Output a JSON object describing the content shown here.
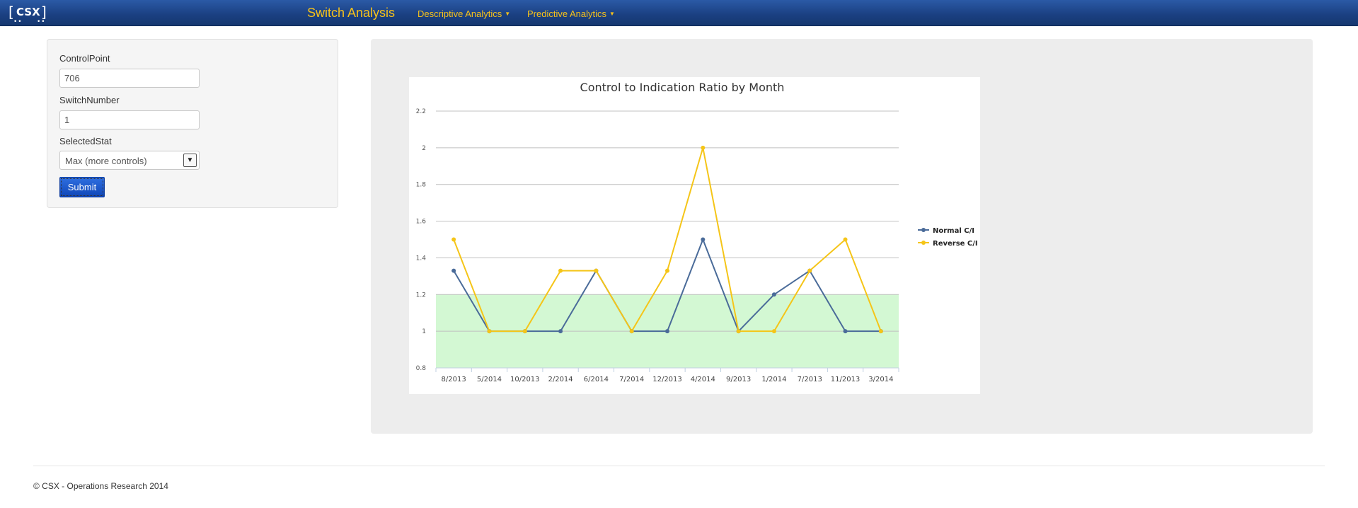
{
  "navbar": {
    "logo_text": "CSX",
    "brand": "Switch Analysis",
    "menus": [
      {
        "label": "Descriptive Analytics"
      },
      {
        "label": "Predictive Analytics"
      }
    ]
  },
  "sidebar": {
    "control_point_label": "ControlPoint",
    "control_point_value": "706",
    "switch_number_label": "SwitchNumber",
    "switch_number_value": "1",
    "selected_stat_label": "SelectedStat",
    "selected_stat_value": "Max (more controls)",
    "submit_label": "Submit"
  },
  "footer": {
    "text": "© CSX - Operations Research 2014"
  },
  "chart_data": {
    "type": "line",
    "title": "Control to Indication Ratio by Month",
    "categories": [
      "8/2013",
      "5/2014",
      "10/2013",
      "2/2014",
      "6/2014",
      "7/2014",
      "12/2013",
      "4/2014",
      "9/2013",
      "1/2014",
      "7/2013",
      "11/2013",
      "3/2014"
    ],
    "yticks": [
      "0.8",
      "1",
      "1.2",
      "1.4",
      "1.6",
      "1.8",
      "2",
      "2.2"
    ],
    "ylim": [
      0.8,
      2.2
    ],
    "band": {
      "from": 0.8,
      "to": 1.2,
      "color": "#d3f8d3"
    },
    "grid": true,
    "legend_position": "right",
    "series": [
      {
        "name": "Normal C/I",
        "color": "#4a6b99",
        "values": [
          1.33,
          1.0,
          1.0,
          1.0,
          1.33,
          1.0,
          1.0,
          1.5,
          1.0,
          1.2,
          1.33,
          1.0,
          1.0
        ]
      },
      {
        "name": "Reverse C/I",
        "color": "#f5c518",
        "values": [
          1.5,
          1.0,
          1.0,
          1.33,
          1.33,
          1.0,
          1.33,
          2.0,
          1.0,
          1.0,
          1.33,
          1.5,
          1.0
        ]
      }
    ]
  }
}
